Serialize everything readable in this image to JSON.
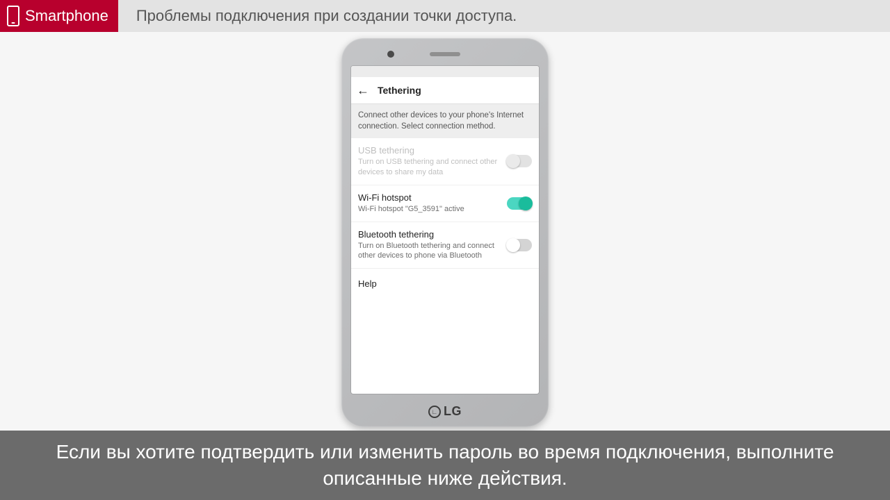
{
  "header": {
    "badge_label": "Smartphone",
    "title": "Проблемы подключения при создании точки доступа."
  },
  "phone": {
    "logo": "LG",
    "screen": {
      "title": "Tethering",
      "description": "Connect other devices to your phone's Internet connection. Select connection method.",
      "usb": {
        "title": "USB tethering",
        "sub": "Turn on USB tethering and connect other devices to share my data"
      },
      "wifi": {
        "title": "Wi-Fi hotspot",
        "sub": "Wi-Fi hotspot \"G5_3591\" active"
      },
      "bt": {
        "title": "Bluetooth tethering",
        "sub": "Turn on Bluetooth tethering and connect other devices to phone via Bluetooth"
      },
      "help": "Help"
    }
  },
  "caption": "Если вы хотите подтвердить или изменить пароль во время подключения, выполните описанные ниже действия."
}
